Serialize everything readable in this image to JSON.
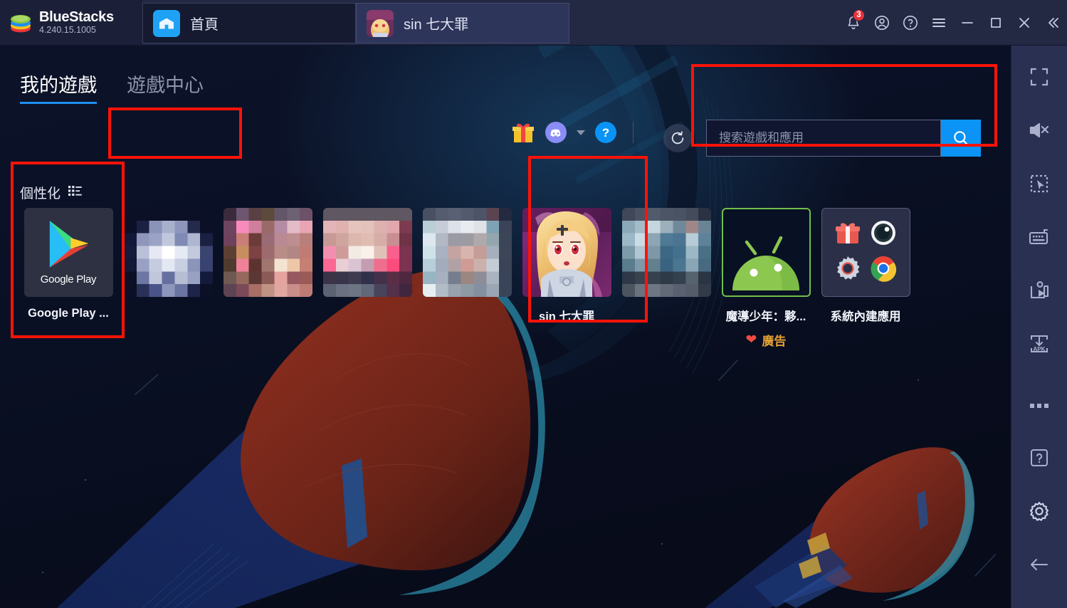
{
  "window": {
    "brand_name": "BlueStacks",
    "version": "4.240.15.1005",
    "tabs": [
      {
        "label": "首頁",
        "icon": "home-icon",
        "active": true
      },
      {
        "label": "sin 七大罪",
        "icon": "game-thumbnail",
        "active": false
      }
    ],
    "controls": {
      "notifications_icon": "bell-icon",
      "notifications_count": "3",
      "account_icon": "account-circle-icon",
      "help_icon": "help-circle-icon",
      "menu_icon": "hamburger-menu-icon",
      "minimize_icon": "minimize-icon",
      "maximize_icon": "maximize-icon",
      "close_icon": "close-icon",
      "collapse_icon": "double-chevron-left-icon"
    }
  },
  "home": {
    "tabs": [
      {
        "label": "我的遊戲",
        "selected": true
      },
      {
        "label": "遊戲中心",
        "selected": false
      }
    ],
    "toolbar": {
      "gift_icon": "gift-icon",
      "discord_icon": "discord-icon",
      "discord_caret": "caret-down-icon",
      "help_icon": "question-mark-icon",
      "refresh_icon": "refresh-counterclockwise-icon"
    },
    "search": {
      "placeholder": "搜索遊戲和應用",
      "value": "",
      "button_icon": "magnifier-icon"
    },
    "section": {
      "title": "個性化",
      "sort_icon": "list-sort-icon"
    },
    "apps": [
      {
        "label": "Google Play ...",
        "icon": "google-play-icon",
        "kind": "google-play",
        "ad": false
      },
      {
        "label": "",
        "icon": "censored-app-icon",
        "kind": "mosaic-a",
        "ad": false
      },
      {
        "label": "",
        "icon": "censored-app-icon",
        "kind": "mosaic-b",
        "ad": false
      },
      {
        "label": "",
        "icon": "censored-app-icon",
        "kind": "mosaic-c",
        "ad": false
      },
      {
        "label": "",
        "icon": "censored-app-icon",
        "kind": "mosaic-d",
        "ad": false
      },
      {
        "label": "sin 七大罪",
        "icon": "sin-nanatsu-no-taizai-icon",
        "kind": "anime",
        "ad": false
      },
      {
        "label": "",
        "icon": "censored-app-icon",
        "kind": "mosaic-e",
        "ad": false
      },
      {
        "label": "魔導少年：夥...",
        "icon": "android-robot-icon",
        "kind": "android",
        "ad": true,
        "ad_label": "廣告"
      },
      {
        "label": "系統內建應用",
        "icon": "system-apps-folder-icon",
        "kind": "system",
        "ad": false
      }
    ]
  },
  "sidebar": {
    "items": [
      {
        "name": "fullscreen-icon"
      },
      {
        "name": "mute-icon"
      },
      {
        "name": "select-region-icon"
      },
      {
        "name": "keyboard-controls-icon"
      },
      {
        "name": "screen-record-icon"
      },
      {
        "name": "install-apk-icon"
      },
      {
        "name": "more-options-icon"
      },
      {
        "name": "help-icon"
      },
      {
        "name": "settings-gear-icon"
      },
      {
        "name": "back-arrow-icon"
      }
    ]
  },
  "annotations": {
    "color": "#fc1308",
    "boxes": [
      {
        "name": "annotation-game-center-tab"
      },
      {
        "name": "annotation-search-bar"
      },
      {
        "name": "annotation-google-play-tile"
      },
      {
        "name": "annotation-sin-game-tile"
      }
    ]
  }
}
